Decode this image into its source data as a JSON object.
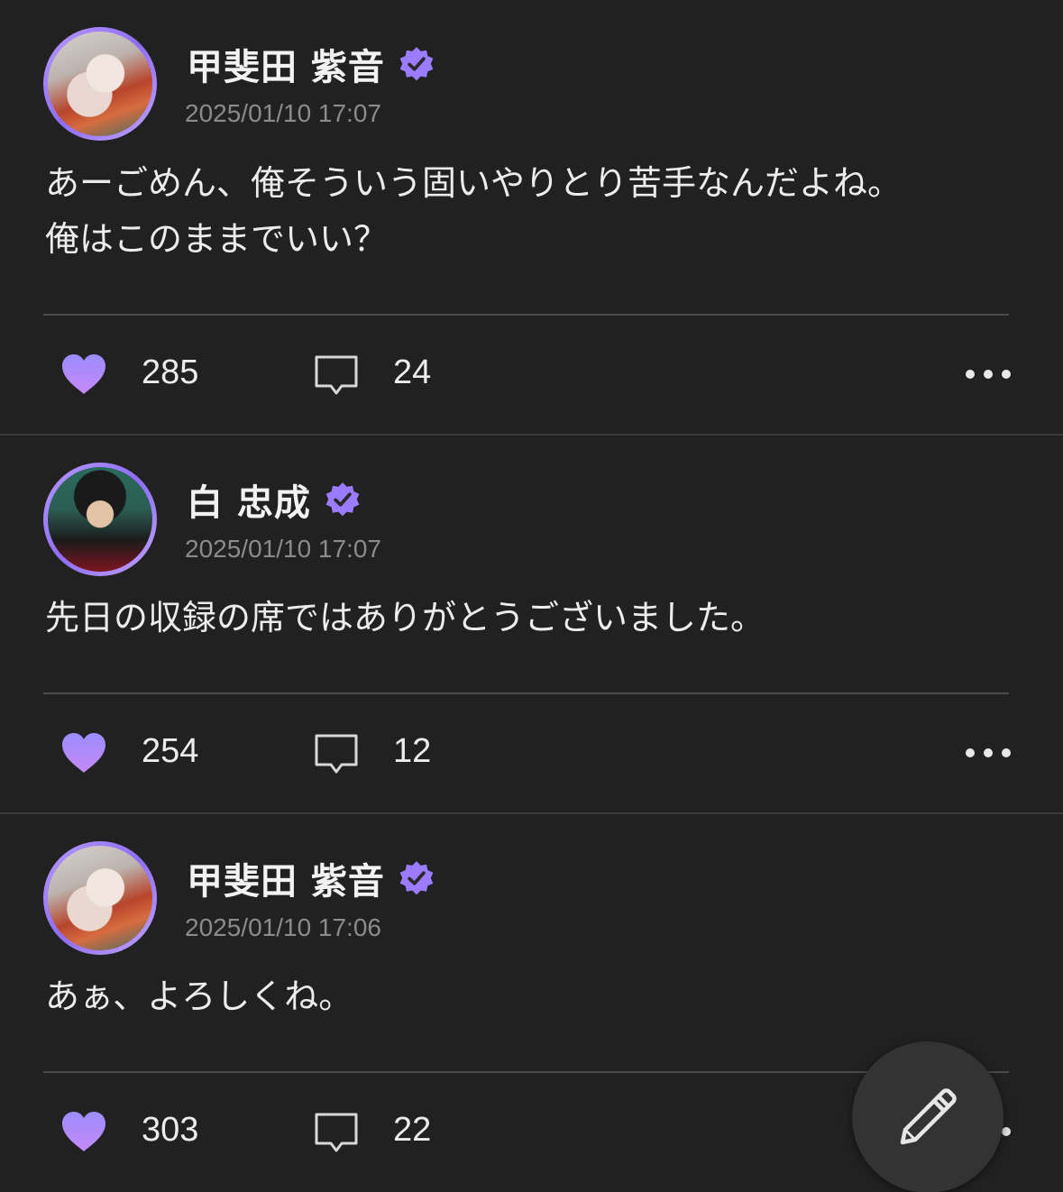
{
  "colors": {
    "background": "#212121",
    "accent_purple": "#9b7bff",
    "divider": "#4a4a4a",
    "text": "#ececec",
    "muted": "#8b8b8b"
  },
  "posts": [
    {
      "author": "甲斐田 紫音",
      "verified": true,
      "timestamp": "2025/01/10 17:07",
      "text": "あーごめん、俺そういう固いやりとり苦手なんだよね。\n俺はこのままでいい？",
      "likes": "285",
      "comments": "24"
    },
    {
      "author": "白 忠成",
      "verified": true,
      "timestamp": "2025/01/10 17:07",
      "text": "先日の収録の席ではありがとうございました。",
      "likes": "254",
      "comments": "12"
    },
    {
      "author": "甲斐田 紫音",
      "verified": true,
      "timestamp": "2025/01/10 17:06",
      "text": "あぁ、よろしくね。",
      "likes": "303",
      "comments": "22"
    }
  ],
  "icons": {
    "like": "heart-icon",
    "comment": "comment-bubble-icon",
    "more": "more-dots-icon",
    "verified": "verified-badge-icon",
    "compose": "pencil-icon"
  }
}
